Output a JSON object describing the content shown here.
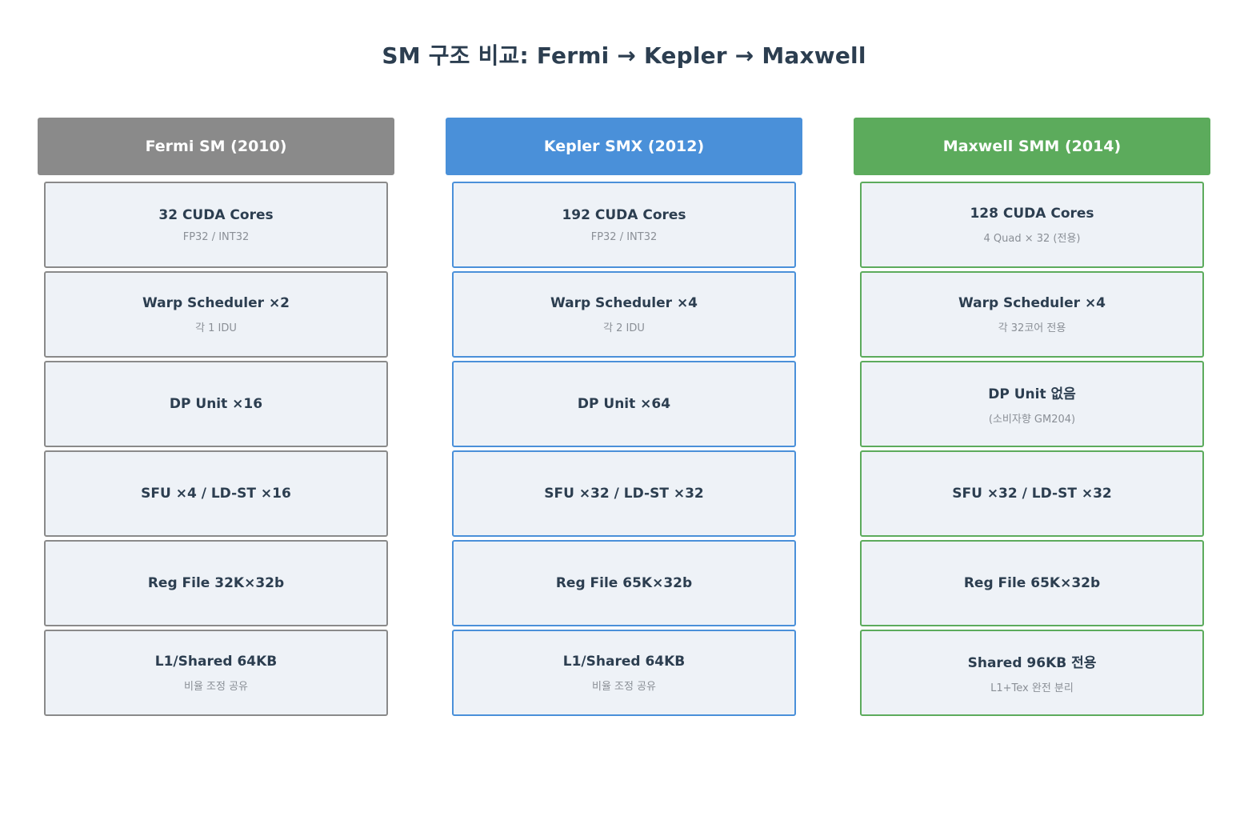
{
  "title": "SM 구조 비교: Fermi → Kepler → Maxwell",
  "columns": [
    {
      "name": "Fermi SM (2010)",
      "color": "#8a8a8a",
      "blocks": [
        {
          "title": "32 CUDA Cores",
          "sub": "FP32 / INT32"
        },
        {
          "title": "Warp Scheduler ×2",
          "sub": "각 1 IDU"
        },
        {
          "title": "DP Unit ×16",
          "sub": ""
        },
        {
          "title": "SFU ×4 / LD-ST ×16",
          "sub": ""
        },
        {
          "title": "Reg File 32K×32b",
          "sub": ""
        },
        {
          "title": "L1/Shared 64KB",
          "sub": "비율 조정 공유"
        }
      ]
    },
    {
      "name": "Kepler SMX (2012)",
      "color": "#4a90d9",
      "blocks": [
        {
          "title": "192 CUDA Cores",
          "sub": "FP32 / INT32"
        },
        {
          "title": "Warp Scheduler ×4",
          "sub": "각 2 IDU"
        },
        {
          "title": "DP Unit ×64",
          "sub": ""
        },
        {
          "title": "SFU ×32 / LD-ST ×32",
          "sub": ""
        },
        {
          "title": "Reg File 65K×32b",
          "sub": ""
        },
        {
          "title": "L1/Shared 64KB",
          "sub": "비율 조정 공유"
        }
      ]
    },
    {
      "name": "Maxwell SMM (2014)",
      "color": "#5cab5c",
      "blocks": [
        {
          "title": "128 CUDA Cores",
          "sub": "4 Quad × 32 (전용)"
        },
        {
          "title": "Warp Scheduler ×4",
          "sub": "각 32코어 전용"
        },
        {
          "title": "DP Unit 없음",
          "sub": "(소비자향 GM204)"
        },
        {
          "title": "SFU ×32 / LD-ST ×32",
          "sub": ""
        },
        {
          "title": "Reg File 65K×32b",
          "sub": ""
        },
        {
          "title": "Shared 96KB 전용",
          "sub": "L1+Tex 완전 분리"
        }
      ]
    }
  ]
}
